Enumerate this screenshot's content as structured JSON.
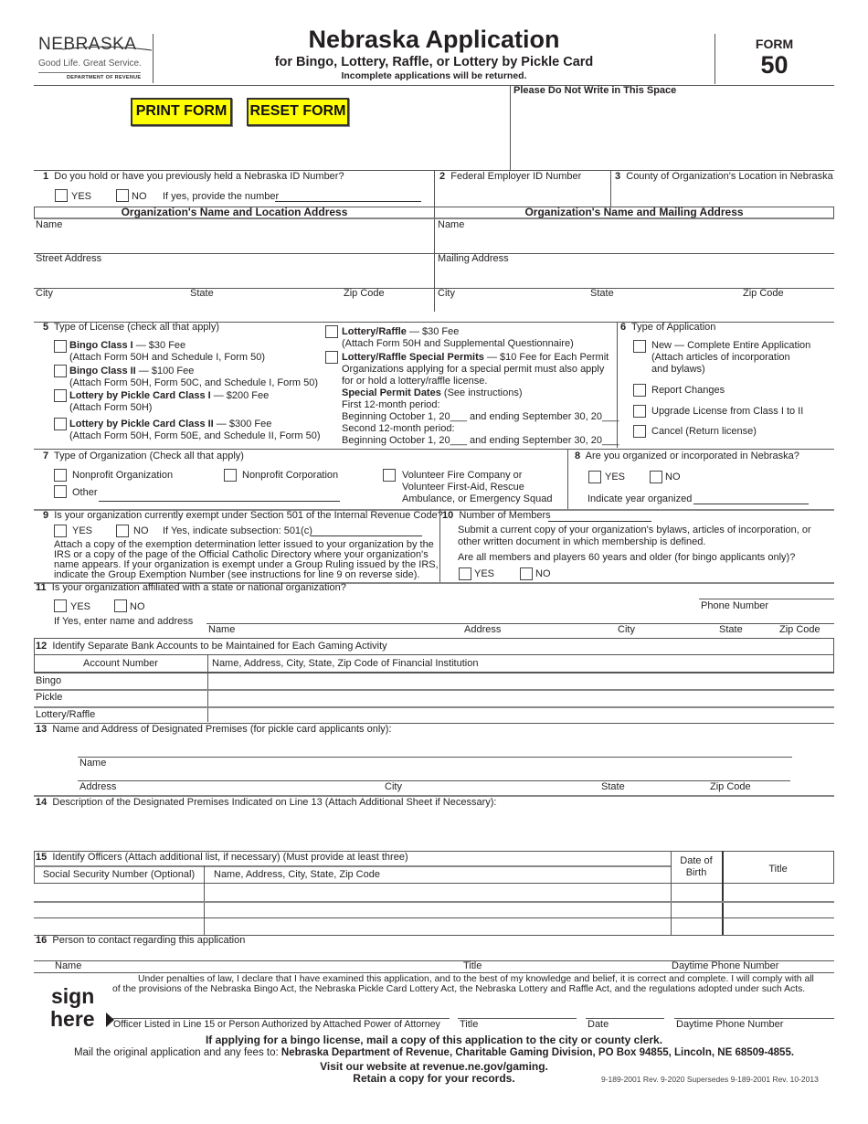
{
  "header": {
    "logo": {
      "name": "NEBRASKA",
      "tagline": "Good Life. Great Service.",
      "department": "DEPARTMENT OF REVENUE"
    },
    "title": "Nebraska Application",
    "subtitle": "for Bingo, Lottery, Raffle, or Lottery by Pickle Card",
    "notice": "Incomplete applications will be returned.",
    "form_label": "FORM",
    "form_number": "50"
  },
  "toolbar": {
    "print_label": "PRINT FORM",
    "reset_label": "RESET FORM"
  },
  "office_use": "Please Do Not Write in This Space",
  "q1": {
    "num": "1",
    "label": "Do you hold or have you previously held a Nebraska ID Number?",
    "yes": "YES",
    "no": "NO",
    "if_yes": "If yes, provide the number"
  },
  "q2": {
    "num": "2",
    "label": "Federal Employer ID Number"
  },
  "q3": {
    "num": "3",
    "label": "County of Organization's Location in Nebraska"
  },
  "location": {
    "heading": "Organization's Name and Location Address",
    "name": "Name",
    "street": "Street Address",
    "city": "City",
    "state": "State",
    "zip": "Zip Code"
  },
  "mailing": {
    "heading": "Organization's Name and Mailing Address",
    "name": "Name",
    "street": "Mailing Address",
    "city": "City",
    "state": "State",
    "zip": "Zip Code"
  },
  "q5": {
    "num": "5",
    "label": "Type of License (check all that apply)",
    "options": [
      {
        "bold": "Bingo Class I",
        "fee": " — $30 Fee",
        "note": "(Attach Form 50H and Schedule I, Form 50)"
      },
      {
        "bold": "Bingo Class II",
        "fee": " — $100 Fee",
        "note": "(Attach Form 50H, Form 50C, and Schedule I, Form 50)"
      },
      {
        "bold": "Lottery by Pickle Card Class I",
        "fee": " — $200 Fee",
        "note": "(Attach Form 50H)"
      },
      {
        "bold": "Lottery by Pickle Card Class II",
        "fee": " — $300 Fee",
        "note": "(Attach Form 50H, Form 50E, and Schedule II, Form 50)"
      },
      {
        "bold": "Lottery/Raffle",
        "fee": " — $30 Fee",
        "note": "(Attach Form 50H and Supplemental Questionnaire)"
      },
      {
        "bold": "Lottery/Raffle Special Permits",
        "fee": " — $10 Fee for Each Permit",
        "note": "Organizations applying for a special permit must also apply",
        "note2": "for or hold a lottery/raffle license."
      }
    ],
    "permit_dates_bold": "Special Permit Dates",
    "permit_dates_note": " (See instructions)",
    "first_period": "First 12-month period:",
    "first_range": "Beginning October 1, 20___ and ending September 30, 20___",
    "second_period": "Second 12-month period:",
    "second_range": "Beginning October 1, 20___ and ending September 30, 20___"
  },
  "q6": {
    "num": "6",
    "label": "Type of Application",
    "options": [
      {
        "line1": "New — Complete Entire Application",
        "line2": "(Attach articles of incorporation",
        "line3": "and bylaws)"
      },
      {
        "line1": "Report Changes"
      },
      {
        "line1": "Upgrade License from Class I to II"
      },
      {
        "line1": "Cancel (Return license)"
      }
    ]
  },
  "q7": {
    "num": "7",
    "label": "Type of Organization (Check all that apply)",
    "nonprofit_org": "Nonprofit Organization",
    "nonprofit_corp": "Nonprofit Corporation",
    "volunteer_1": "Volunteer Fire Company or",
    "volunteer_2": "Volunteer First-Aid, Rescue",
    "volunteer_3": "Ambulance, or Emergency Squad",
    "other": "Other"
  },
  "q8": {
    "num": "8",
    "label": "Are you organized or incorporated in Nebraska?",
    "yes": "YES",
    "no": "NO",
    "year": "Indicate year organized"
  },
  "q9": {
    "num": "9",
    "label": "Is your organization currently exempt under Section 501 of the Internal Revenue Code?",
    "yes": "YES",
    "no": "NO",
    "subsection": "If Yes, indicate subsection: 501(c)",
    "note": [
      "Attach a copy of the exemption determination letter issued to your organization by the",
      "IRS or a copy of the page of the Official Catholic Directory where your organization's",
      "name appears. If your organization is exempt under a Group Ruling issued by the IRS,",
      "indicate the Group Exemption Number (see instructions for line 9 on reverse side)."
    ]
  },
  "q10": {
    "num": "10",
    "label": "Number of Members",
    "note1": "Submit a current copy of your organization's bylaws, articles of incorporation, or",
    "note2": "other written document in which membership is defined.",
    "question": "Are all members and players 60 years and older (for bingo applicants only)?",
    "yes": "YES",
    "no": "NO"
  },
  "q11": {
    "num": "11",
    "label": "Is your organization affiliated with a state or national organization?",
    "yes": "YES",
    "no": "NO",
    "if_yes": "If Yes, enter name and address",
    "phone": "Phone Number",
    "name": "Name",
    "address": "Address",
    "city": "City",
    "state": "State",
    "zip": "Zip Code"
  },
  "q12": {
    "num": "12",
    "label": "Identify Separate Bank Accounts to be Maintained for Each Gaming Activity",
    "col_account": "Account Number",
    "col_institution": "Name, Address, City, State, Zip Code of Financial Institution",
    "rows": [
      "Bingo",
      "Pickle",
      "Lottery/Raffle"
    ]
  },
  "q13": {
    "num": "13",
    "label": "Name and Address of Designated Premises (for pickle card applicants only):",
    "name": "Name",
    "address": "Address",
    "city": "City",
    "state": "State",
    "zip": "Zip Code"
  },
  "q14": {
    "num": "14",
    "label": "Description of the Designated Premises Indicated on Line 13 (Attach Additional Sheet if Necessary):"
  },
  "q15": {
    "num": "15",
    "label": "Identify Officers (Attach additional list, if necessary) (Must provide at least three)",
    "col_ssn": "Social Security Number (Optional)",
    "col_name": "Name, Address, City, State, Zip Code",
    "col_dob_1": "Date of",
    "col_dob_2": "Birth",
    "col_title": "Title"
  },
  "q16": {
    "num": "16",
    "label": "Person to contact regarding this application",
    "name": "Name",
    "title": "Title",
    "phone": "Daytime Phone Number"
  },
  "signature": {
    "declaration_1": "Under penalties of law, I declare that I have examined this application, and to the best of my knowledge and belief, it is correct and complete. I will comply with all",
    "declaration_2": "of the provisions of the Nebraska Bingo Act, the Nebraska Pickle Card Lottery Act, the Nebraska Lottery and Raffle Act, and the regulations adopted under such Acts.",
    "sign": "sign",
    "here": "here",
    "officer": "Officer Listed in Line 15 or Person Authorized by Attached Power of Attorney",
    "title": "Title",
    "date": "Date",
    "phone": "Daytime Phone Number"
  },
  "footer": {
    "bingo_notice": "If applying for a bingo license, mail a copy of this application to the city or county clerk.",
    "mail_prefix": "Mail the original application and any fees to: ",
    "mail_address": "Nebraska Department of Revenue, Charitable Gaming Division, PO Box 94855, Lincoln, NE 68509-4855.",
    "website": "Visit our website at revenue.ne.gov/gaming.",
    "retain": "Retain a copy for your records.",
    "revision": "9-189-2001 Rev. 9-2020 Supersedes 9-189-2001 Rev. 10-2013"
  }
}
